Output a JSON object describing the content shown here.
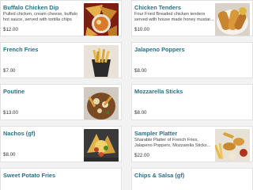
{
  "menu": {
    "items": [
      {
        "name": "Buffalo Chicken Dip",
        "description": "Pulled chicken, cream cheese, buffalo hot sauce, served with tortilla chips",
        "price": "$12.00",
        "image_icon": "food-photo-icon"
      },
      {
        "name": "Chicken Tenders",
        "description": "Four Fried Breaded chicken tenders served with house made honey mustar...",
        "price": "$10.00",
        "image_icon": "food-photo-icon"
      },
      {
        "name": "French Fries",
        "description": "",
        "price": "$7.00",
        "image_icon": "food-photo-icon"
      },
      {
        "name": "Jalapeno Poppers",
        "description": "",
        "price": "$8.00",
        "image_icon": ""
      },
      {
        "name": "Poutine",
        "description": "",
        "price": "$13.00",
        "image_icon": "food-photo-icon"
      },
      {
        "name": "Mozzarella Sticks",
        "description": "",
        "price": "$8.00",
        "image_icon": ""
      },
      {
        "name": "Nachos (gf)",
        "description": "",
        "price": "$8.00",
        "image_icon": "food-photo-icon"
      },
      {
        "name": "Sampler Platter",
        "description": "Sharable Platter of French Fries, Jalapeno Poppers, Mozzarella Sticks...",
        "price": "$22.00",
        "image_icon": "food-photo-icon"
      },
      {
        "name": "Sweet Potato Fries",
        "description": "",
        "price": "",
        "image_icon": ""
      },
      {
        "name": "Chips & Salsa (gf)",
        "description": "",
        "price": "",
        "image_icon": ""
      }
    ]
  },
  "colors": {
    "title": "#2a6f86",
    "background": "#f2f2f2",
    "card": "#ffffff"
  }
}
